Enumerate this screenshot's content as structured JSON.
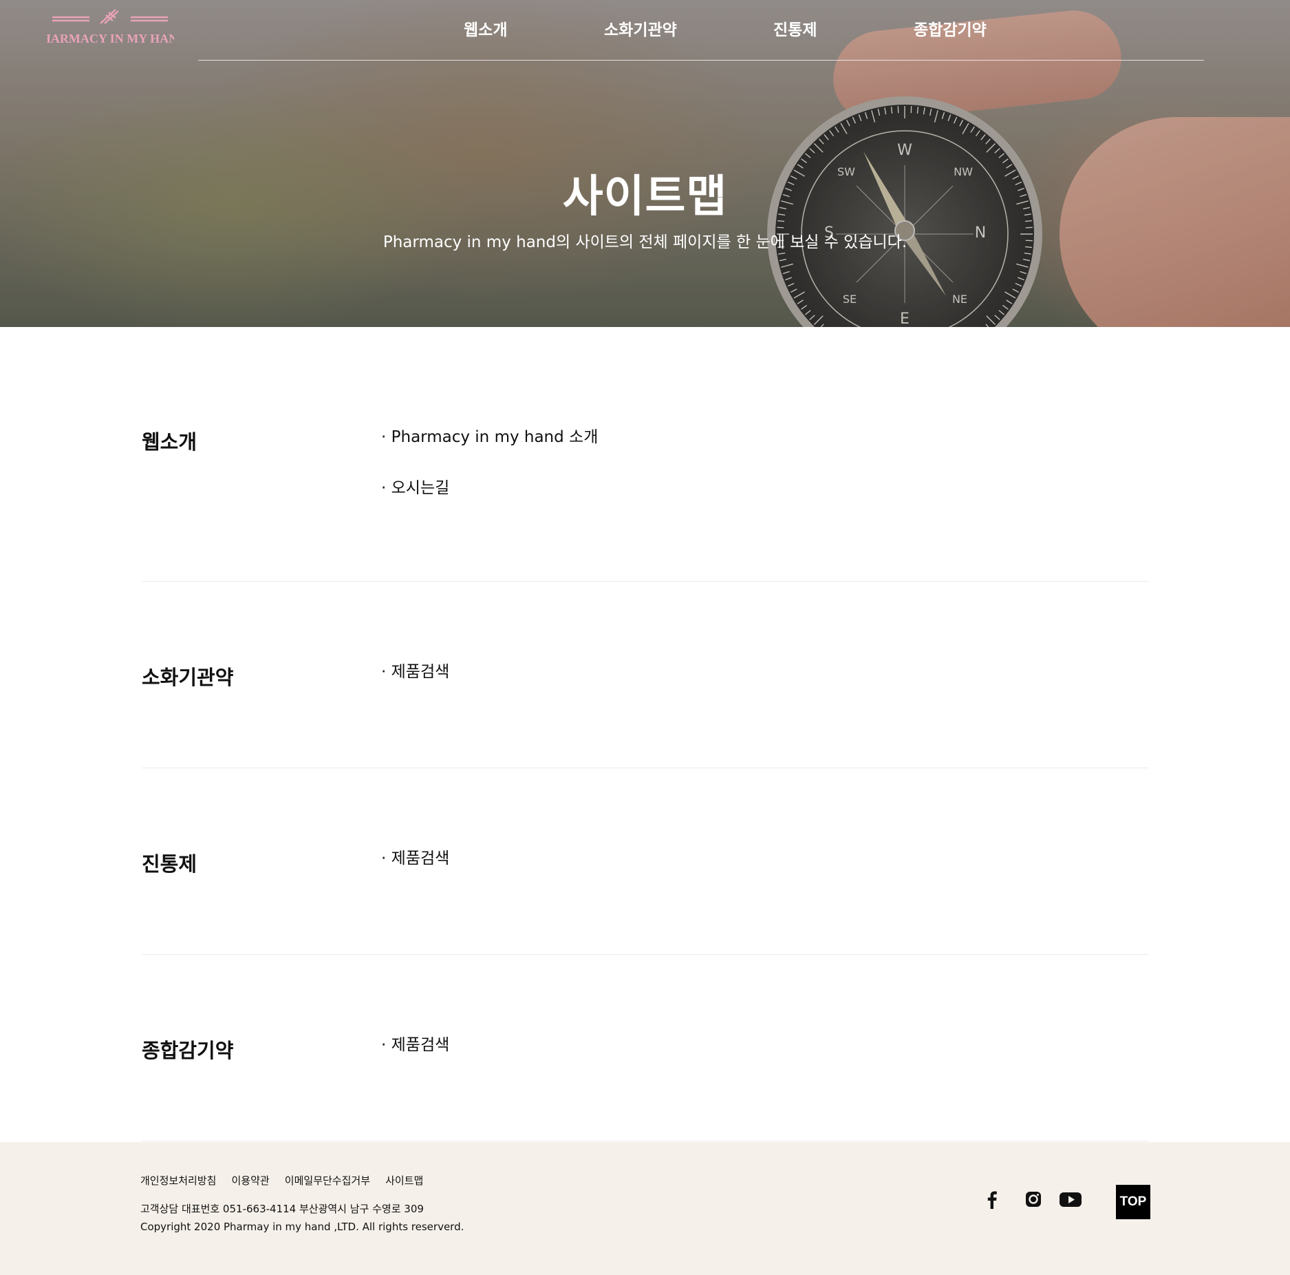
{
  "header": {
    "logo_text": "PHARMACY IN MY HAND",
    "nav": [
      {
        "label": "웹소개"
      },
      {
        "label": "소화기관약"
      },
      {
        "label": "진통제"
      },
      {
        "label": "종합감기약"
      }
    ]
  },
  "hero": {
    "title": "사이트맵",
    "subtitle": "Pharmacy in my hand의 사이트의 전체 페이지를 한 눈에 보실 수 있습니다."
  },
  "sitemap": [
    {
      "title": "웹소개",
      "links": [
        "Pharmacy in my hand 소개",
        "오시는길"
      ]
    },
    {
      "title": "소화기관약",
      "links": [
        "제품검색"
      ]
    },
    {
      "title": "진통제",
      "links": [
        "제품검색"
      ]
    },
    {
      "title": "종합감기약",
      "links": [
        "제품검색"
      ]
    }
  ],
  "footer": {
    "links": [
      "개인정보처리방침",
      "이용약관",
      "이메일무단수집거부",
      "사이트맵"
    ],
    "contact": "고객상담 대표번호 051-663-4114 부산광역시 남구 수영로 309",
    "copyright": "Copyright 2020 Pharmay in my hand ,LTD. All rights reserverd.",
    "social": [
      {
        "icon": "facebook-icon"
      },
      {
        "icon": "instagram-icon"
      },
      {
        "icon": "youtube-icon"
      }
    ],
    "top_label": "TOP"
  },
  "colors": {
    "logo": "#e8a3b8",
    "footer_bg": "#f5f0e9",
    "divider": "#ececec"
  }
}
